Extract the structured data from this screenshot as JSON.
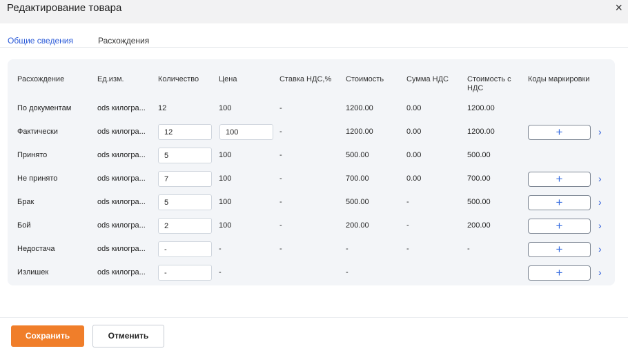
{
  "dialog": {
    "title": "Редактирование товара",
    "close_icon": "×"
  },
  "tabs": [
    {
      "label": "Общие сведения",
      "active": true
    },
    {
      "label": "Расхождения",
      "active": false
    }
  ],
  "table": {
    "headers": {
      "discrepancy": "Расхождение",
      "unit": "Ед.изм.",
      "quantity": "Количество",
      "price": "Цена",
      "vat_rate": "Ставка НДС,%",
      "cost": "Стоимость",
      "vat_sum": "Сумма НДС",
      "cost_with_vat_1": "Стоимость с",
      "cost_with_vat_2": "НДС",
      "marking_codes": "Коды маркировки"
    },
    "rows": [
      {
        "name": "По документам",
        "unit": "ods килогра...",
        "quantity": "12",
        "price": "100",
        "vat_rate": "-",
        "cost": "1200.00",
        "vat_sum": "0.00",
        "cost_with_vat": "1200.00"
      },
      {
        "name": "Фактически",
        "unit": "ods килогра...",
        "quantity": "12",
        "price": "100",
        "vat_rate": "-",
        "cost": "1200.00",
        "vat_sum": "0.00",
        "cost_with_vat": "1200.00"
      },
      {
        "name": "Принято",
        "unit": "ods килогра...",
        "quantity": "5",
        "price": "100",
        "vat_rate": "-",
        "cost": "500.00",
        "vat_sum": "0.00",
        "cost_with_vat": "500.00"
      },
      {
        "name": "Не принято",
        "unit": "ods килогра...",
        "quantity": "7",
        "price": "100",
        "vat_rate": "-",
        "cost": "700.00",
        "vat_sum": "0.00",
        "cost_with_vat": "700.00"
      },
      {
        "name": "Брак",
        "unit": "ods килогра...",
        "quantity": "5",
        "price": "100",
        "vat_rate": "-",
        "cost": "500.00",
        "vat_sum": "-",
        "cost_with_vat": "500.00"
      },
      {
        "name": "Бой",
        "unit": "ods килогра...",
        "quantity": "2",
        "price": "100",
        "vat_rate": "-",
        "cost": "200.00",
        "vat_sum": "-",
        "cost_with_vat": "200.00"
      },
      {
        "name": "Недостача",
        "unit": "ods килогра...",
        "quantity": "-",
        "price": "-",
        "vat_rate": "-",
        "cost": "-",
        "vat_sum": "-",
        "cost_with_vat": "-"
      },
      {
        "name": "Излишек",
        "unit": "ods килогра...",
        "quantity": "-",
        "price": "-",
        "vat_rate": "",
        "cost": "-",
        "vat_sum": "",
        "cost_with_vat": ""
      }
    ],
    "add_code_icon": "+",
    "expand_icon": "›"
  },
  "footer": {
    "save_label": "Сохранить",
    "cancel_label": "Отменить"
  },
  "colors": {
    "accent": "#2a5ad8",
    "save_button": "#f07e2a",
    "panel_bg": "#f3f5f8"
  }
}
